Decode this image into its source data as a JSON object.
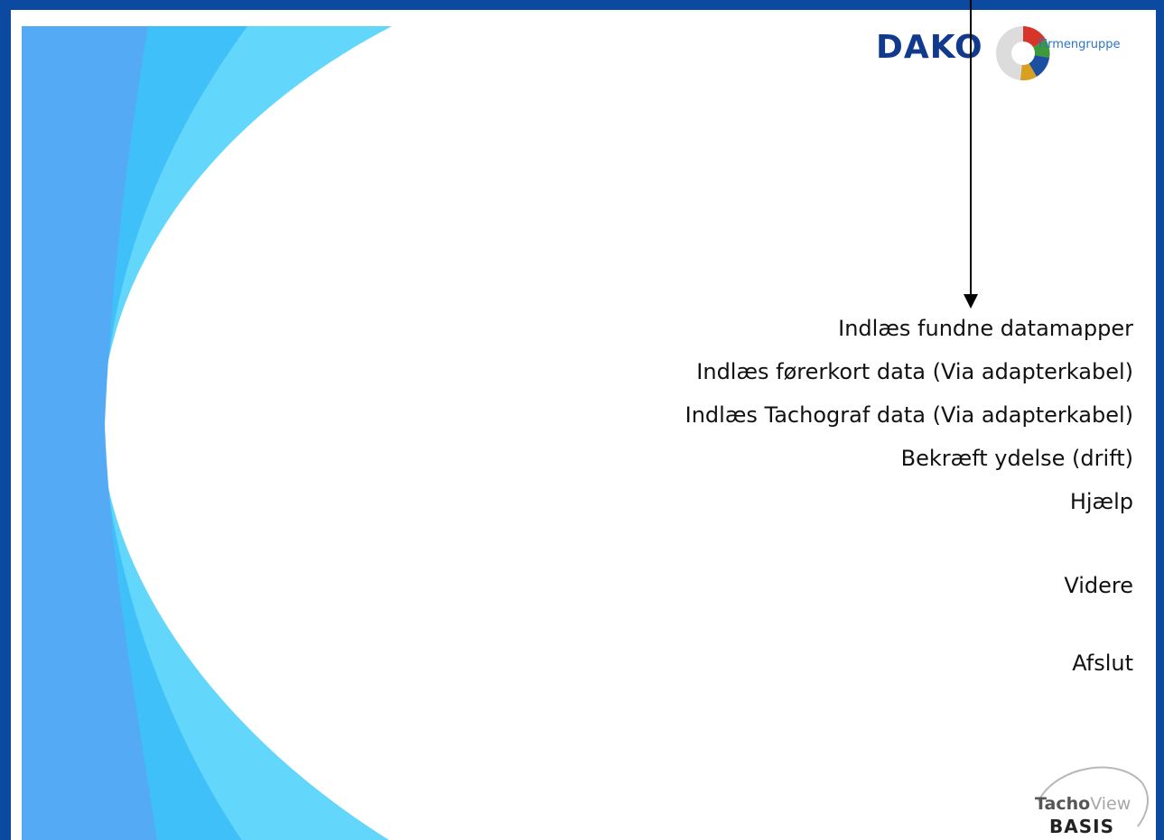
{
  "brand": {
    "logo_name": "DAKO",
    "logo_sub": "Firmengruppe",
    "product_name_part1": "Tacho",
    "product_name_part2": "View",
    "product_edition": "BASIS"
  },
  "menu": {
    "items": [
      {
        "label": "Indlæs fundne datamapper"
      },
      {
        "label": "Indlæs førerkort data (Via adapterkabel)"
      },
      {
        "label": "Indlæs Tachograf data (Via adapterkabel)"
      },
      {
        "label": "Bekræft ydelse (drift)"
      },
      {
        "label": "Hjælp"
      },
      {
        "label": "Videre"
      },
      {
        "label": "Afslut"
      }
    ]
  },
  "colors": {
    "frame": "#0b4aa0",
    "swoosh_dark": "#55aaf5",
    "swoosh_mid": "#3fc0f8",
    "swoosh_light": "#62d6fb",
    "brand_blue": "#123a8c"
  },
  "icons": {
    "logo_mark": "dako-pie-logo-icon",
    "annotation_arrow": "arrow-down-icon"
  }
}
